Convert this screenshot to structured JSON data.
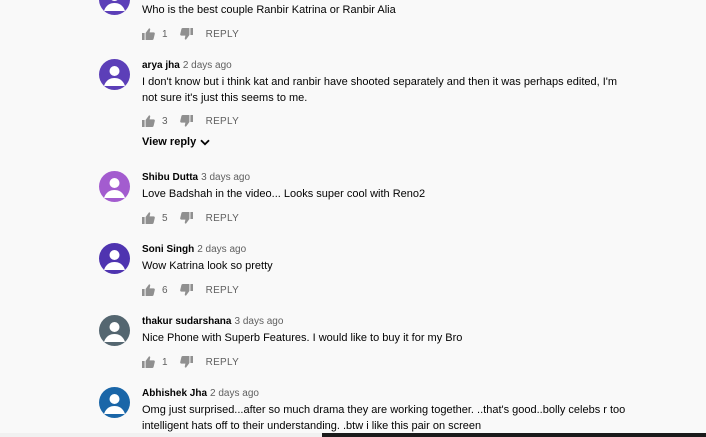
{
  "colors": {
    "avatar_purple": "#5c3fb8",
    "avatar_violet": "#a35ccf",
    "avatar_indigo": "#4f34b0",
    "avatar_slate": "#546670",
    "avatar_blue": "#1a66a8"
  },
  "icons": {
    "like": "thumb-up-icon",
    "dislike": "thumb-down-icon",
    "expand": "chevron-down-icon"
  },
  "comments": [
    {
      "author": "",
      "time": "",
      "text": "Who is the best couple Ranbir Katrina or Ranbir Alia",
      "likes": "1",
      "reply_label": "REPLY"
    },
    {
      "author": "arya jha",
      "time": "2 days ago",
      "text": "I don't know but i think kat and ranbir have shooted separately and then it was perhaps edited, I'm not sure it's just this seems to me.",
      "likes": "3",
      "reply_label": "REPLY",
      "view_reply_label": "View reply"
    },
    {
      "author": "Shibu Dutta",
      "time": "3 days ago",
      "text": "Love Badshah in the video... Looks super cool with Reno2",
      "likes": "5",
      "reply_label": "REPLY"
    },
    {
      "author": "Soni Singh",
      "time": "2 days ago",
      "text": "Wow Katrina look so pretty",
      "likes": "6",
      "reply_label": "REPLY"
    },
    {
      "author": "thakur sudarshana",
      "time": "3 days ago",
      "text": "Nice Phone with Superb Features. I would like to buy it for my Bro",
      "likes": "1",
      "reply_label": "REPLY"
    },
    {
      "author": "Abhishek Jha",
      "time": "2 days ago",
      "text": "Omg just surprised...after so much drama they are working together. ..that's good..bolly celebs r too intelligent hats  off to their understanding. .btw i like this pair on screen",
      "likes": "",
      "reply_label": ""
    }
  ]
}
